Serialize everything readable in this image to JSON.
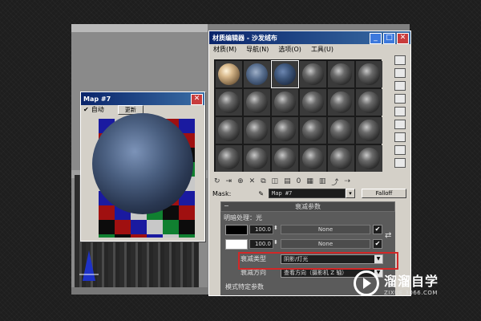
{
  "map_window": {
    "title": "Map #7",
    "auto_checkbox_label": "自动",
    "update_button_label": "更新"
  },
  "material_editor": {
    "title": "材质编辑器 - 沙发绒布",
    "menu": [
      "材质(M)",
      "导航(N)",
      "选项(O)",
      "工具(U)"
    ],
    "mask_label": "Mask:",
    "map_name": "Map #7",
    "map_type_button": "Falloff",
    "rollout_title": "衰减参数",
    "section_label": "明暗处理：光",
    "row1": {
      "amount": "100.0",
      "map_button": "None"
    },
    "row2": {
      "amount": "100.0",
      "map_button": "None"
    },
    "falloff_type_label": "衰减类型",
    "falloff_type_value": "阴影/灯光",
    "falloff_direction_label": "衰减方向",
    "falloff_direction_value": "查看方向（摄影机 Z 轴）",
    "mode_specific_label": "模式特定参数"
  },
  "watermark": {
    "name": "溜溜自学",
    "url": "ZIXUE.3066.COM"
  },
  "colors": {
    "titlebar_start": "#0a246a",
    "titlebar_end": "#3a6ea5",
    "highlight_box": "#d22828",
    "rollout_bg": "#5b5b5b"
  }
}
